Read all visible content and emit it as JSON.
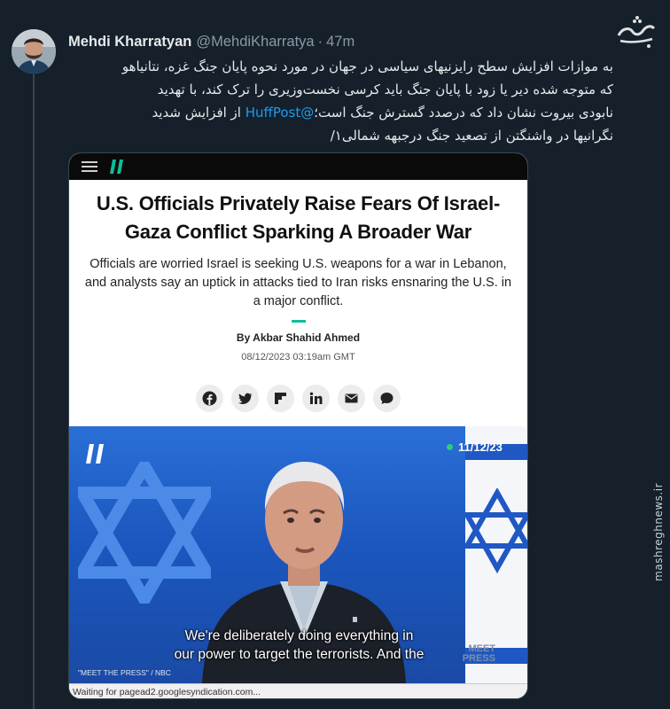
{
  "watermark": {
    "logo_text": "مشرق",
    "vertical_text": "mashreghnews.ir"
  },
  "tweet": {
    "display_name": "Mehdi Kharratyan",
    "handle": "@MehdiKharratya",
    "separator": "·",
    "time": "47m",
    "text_lines": [
      "به موازات افزایش سطح رایزنیهای سیاسی در جهان در مورد نحوه پایان جنگ غزه، نتانیاهو",
      "که متوجه شده دیر یا زود با پایان جنگ باید کرسی نخست‌وزیری را ترک کند، با تهدید",
      "نابودی بیروت نشان داد که درصدد گسترش جنگ است؛",
      "از افزایش شدید",
      "نگرانیها در واشنگتن از تصعید جنگ درجبهه شمالی۱/"
    ],
    "mention": "@HuffPost"
  },
  "card": {
    "headline": "U.S. Officials Privately Raise Fears Of Israel-Gaza Conflict Sparking A Broader War",
    "subhead": "Officials are worried Israel is seeking U.S. weapons for a war in Lebanon, and analysts say an uptick in attacks tied to Iran risks ensnaring the U.S. in a major conflict.",
    "byline": "By Akbar Shahid Ahmed",
    "dateline": "08/12/2023 03:19am GMT",
    "share_buttons": [
      "facebook-icon",
      "twitter-icon",
      "flipboard-icon",
      "linkedin-icon",
      "email-icon",
      "comment-icon"
    ],
    "video": {
      "date_badge": "11/12/23",
      "caption_line1": "We're deliberately doing everything in",
      "caption_line2": "our power to target the terrorists. And the",
      "credit": "\"MEET THE PRESS\" / NBC",
      "network_mark_1": "MEET",
      "network_mark_2": "PRESS"
    },
    "status_bar": "Waiting for pagead2.googlesyndication.com..."
  },
  "colors": {
    "background": "#15202b",
    "mention": "#1d9bf0",
    "huffpost_green": "#0dbe98"
  }
}
